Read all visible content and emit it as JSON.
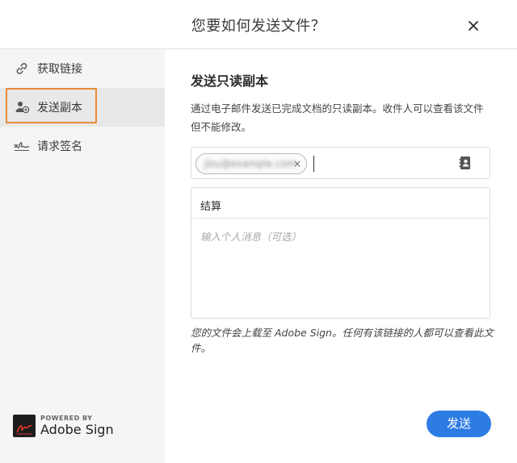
{
  "dialog": {
    "title": "您要如何发送文件？"
  },
  "sidebar": {
    "items": [
      {
        "label": "获取链接",
        "icon": "link-icon"
      },
      {
        "label": "发送副本",
        "icon": "add-user-icon",
        "active": true
      },
      {
        "label": "请求签名",
        "icon": "signature-icon"
      }
    ]
  },
  "main": {
    "title": "发送只读副本",
    "description": "通过电子邮件发送已完成文档的只读副本。收件人可以查看该文件但不能修改。",
    "recipient_chip": "jlzu@example.com",
    "subject": "结算",
    "message_placeholder": "输入个人消息（可选）",
    "notice": "您的文件会上载至 Adobe Sign。任何有该链接的人都可以查看此文件。",
    "send_label": "发送"
  },
  "brand": {
    "powered": "POWERED BY",
    "name": "Adobe Sign"
  },
  "colors": {
    "accent": "#2d7ce4",
    "highlight": "#ea8a3a",
    "sidebar_bg": "#f5f5f5"
  }
}
